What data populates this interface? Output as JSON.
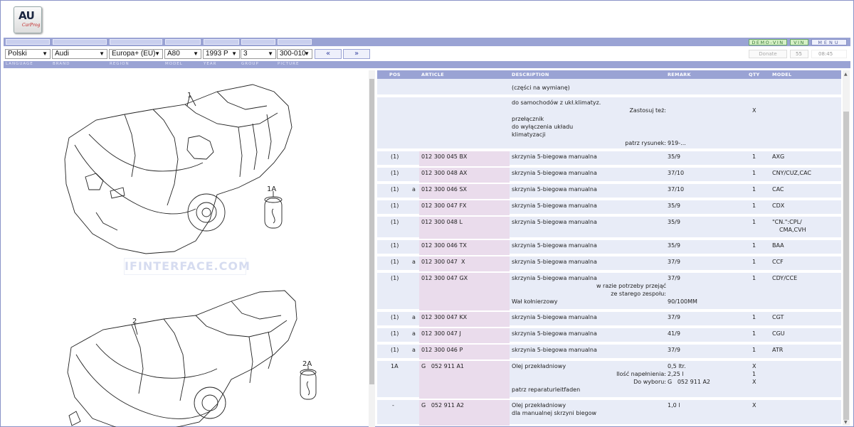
{
  "logo": {
    "mark": "AU",
    "sub": "CarProg"
  },
  "toolbar": {
    "demo_vin": "DEMO-VIN",
    "vin": "VIN",
    "menu": "MENU"
  },
  "selectors": {
    "language": "Polski",
    "brand": "Audi",
    "region": "Europa+ (EU)",
    "model": "A80",
    "year": "1993  P",
    "group": "3",
    "picture": "300-010",
    "prev": "«",
    "next": "»",
    "donate": "Donate",
    "count": "55",
    "time": "08:45"
  },
  "labels": {
    "language": "LANGUAGE",
    "brand": "BRAND",
    "region": "REGION",
    "model": "MODEL",
    "year": "YEAR",
    "group": "GROUP",
    "picture": "PICTURE"
  },
  "diagram": {
    "callouts": [
      "1",
      "1A",
      "2",
      "2A"
    ],
    "watermark": "IFINTERFACE.COM"
  },
  "columns": {
    "pos": "POS",
    "article": "ARTICLE",
    "description": "DESCRIPTION",
    "remark": "REMARK",
    "qty": "QTY",
    "model": "MODEL"
  },
  "rows": [
    {
      "pos": "",
      "flag": "",
      "article": "",
      "desc": [
        "",
        "(części na wymianę)"
      ],
      "remark": "",
      "qty": "",
      "model": ""
    },
    {
      "pos": "",
      "flag": "",
      "article": "",
      "desc": [
        "do samochodów z ukł.klimatyz.",
        "",
        "przełącznik",
        "do wyłączenia układu",
        "klimatyzacji"
      ],
      "note_right": "Zastosuj też:",
      "note_right2": "patrz rysunek:",
      "remark2": "919-...",
      "qty": "X",
      "model": ""
    },
    {
      "pos": "(1)",
      "flag": "",
      "article": "012 300 045 BX",
      "desc": [
        "skrzynia 5-biegowa manualna"
      ],
      "remark": "35/9",
      "qty": "1",
      "model": "AXG"
    },
    {
      "pos": "(1)",
      "flag": "",
      "article": "012 300 048 AX",
      "desc": [
        "skrzynia 5-biegowa manualna"
      ],
      "remark": "37/10",
      "qty": "1",
      "model": "CNY/CUZ,CAC"
    },
    {
      "pos": "(1)",
      "flag": "a",
      "article": "012 300 046 SX",
      "desc": [
        "skrzynia 5-biegowa manualna"
      ],
      "remark": "37/10",
      "qty": "1",
      "model": "CAC"
    },
    {
      "pos": "(1)",
      "flag": "",
      "article": "012 300 047 FX",
      "desc": [
        "skrzynia 5-biegowa manualna"
      ],
      "remark": "35/9",
      "qty": "1",
      "model": "CDX"
    },
    {
      "pos": "(1)",
      "flag": "",
      "article": "012 300 048 L",
      "desc": [
        "skrzynia 5-biegowa manualna"
      ],
      "remark": "35/9",
      "qty": "1",
      "model": "\"CN.\":CPL/",
      "model2": "CMA,CVH"
    },
    {
      "pos": "(1)",
      "flag": "",
      "article": "012 300 046 TX",
      "desc": [
        "skrzynia 5-biegowa manualna"
      ],
      "remark": "35/9",
      "qty": "1",
      "model": "BAA"
    },
    {
      "pos": "(1)",
      "flag": "a",
      "article": "012 300 047  X",
      "desc": [
        "skrzynia 5-biegowa manualna"
      ],
      "remark": "37/9",
      "qty": "1",
      "model": "CCF"
    },
    {
      "pos": "(1)",
      "flag": "",
      "article": "012 300 047 GX",
      "desc": [
        "skrzynia 5-biegowa manualna"
      ],
      "note_right": "w razie potrzeby przejąć",
      "note_right2": "ze starego zespołu:",
      "desc3": "Wał kołnierzowy",
      "remark": "37/9",
      "remark3": "90/100MM",
      "qty": "1",
      "model": "CDY/CCE"
    },
    {
      "pos": "(1)",
      "flag": "a",
      "article": "012 300 047 KX",
      "desc": [
        "skrzynia 5-biegowa manualna"
      ],
      "remark": "37/9",
      "qty": "1",
      "model": "CGT"
    },
    {
      "pos": "(1)",
      "flag": "a",
      "article": "012 300 047 J",
      "desc": [
        "skrzynia 5-biegowa manualna"
      ],
      "remark": "41/9",
      "qty": "1",
      "model": "CGU"
    },
    {
      "pos": "(1)",
      "flag": "a",
      "article": "012 300 046 P",
      "desc": [
        "skrzynia 5-biegowa manualna"
      ],
      "remark": "37/9",
      "qty": "1",
      "model": "ATR"
    },
    {
      "pos": "1A",
      "flag": "",
      "article": "G   052 911 A1",
      "desc": [
        "Olej przekładniowy"
      ],
      "note_right": "Ilość napełnienia:",
      "note_right2": "Do wyboru:",
      "desc4": "patrz reparaturleitfaden",
      "remark": "0,5 ltr.",
      "remark2": "2,25 l",
      "remark3": "G   052 911 A2",
      "qty": "X",
      "qty2": "1",
      "qty3": "X",
      "model": ""
    },
    {
      "pos": "-",
      "flag": "",
      "article": "G   052 911 A2",
      "desc": [
        "Olej przekładniowy",
        "dla manualnej skrzyni biegow"
      ],
      "remark": "1,0 l",
      "qty": "X",
      "model": ""
    }
  ]
}
